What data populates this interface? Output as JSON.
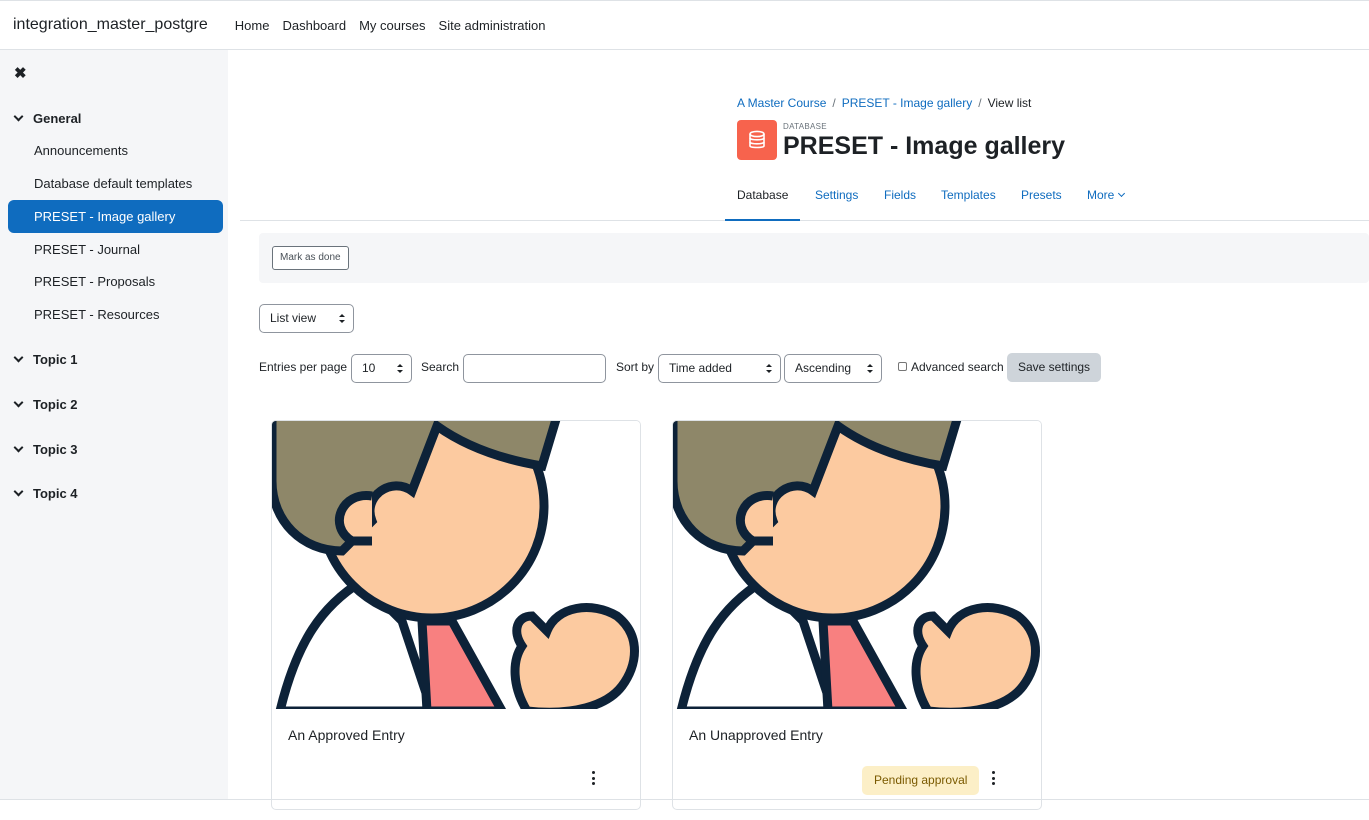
{
  "site": {
    "name": "integration_master_postgre",
    "nav": [
      "Home",
      "Dashboard",
      "My courses",
      "Site administration"
    ]
  },
  "drawer": {
    "close_icon": "close-icon",
    "sections": [
      {
        "label": "General",
        "activities": [
          "Announcements",
          "Database default templates",
          "PRESET - Image gallery",
          "PRESET - Journal",
          "PRESET - Proposals",
          "PRESET - Resources"
        ]
      },
      {
        "label": "Topic 1"
      },
      {
        "label": "Topic 2"
      },
      {
        "label": "Topic 3"
      },
      {
        "label": "Topic 4"
      }
    ],
    "active_activity": "PRESET - Image gallery"
  },
  "breadcrumb": [
    "A Master Course",
    "PRESET - Image gallery",
    "View list"
  ],
  "header": {
    "module_type": "DATABASE",
    "title": "PRESET - Image gallery",
    "icon": "database-icon",
    "icon_color": "#f7634d"
  },
  "tabs": [
    "Database",
    "Settings",
    "Fields",
    "Templates",
    "Presets",
    "More"
  ],
  "active_tab": "Database",
  "completion": {
    "mark_done_label": "Mark as done"
  },
  "view_selector": {
    "selected": "List view"
  },
  "controls": {
    "entries_label": "Entries per page",
    "entries_value": "10",
    "search_label": "Search",
    "search_value": "",
    "sort_label": "Sort by",
    "sort_value": "Time added",
    "order_value": "Ascending",
    "advanced_label": "Advanced search",
    "save_label": "Save settings"
  },
  "entries": [
    {
      "title": "An Approved Entry",
      "status": ""
    },
    {
      "title": "An Unapproved Entry",
      "status": "Pending approval"
    }
  ],
  "colors": {
    "primary": "#0f6cbf",
    "drawer_bg": "#f5f6f8",
    "badge_bg": "#fcefc7"
  }
}
